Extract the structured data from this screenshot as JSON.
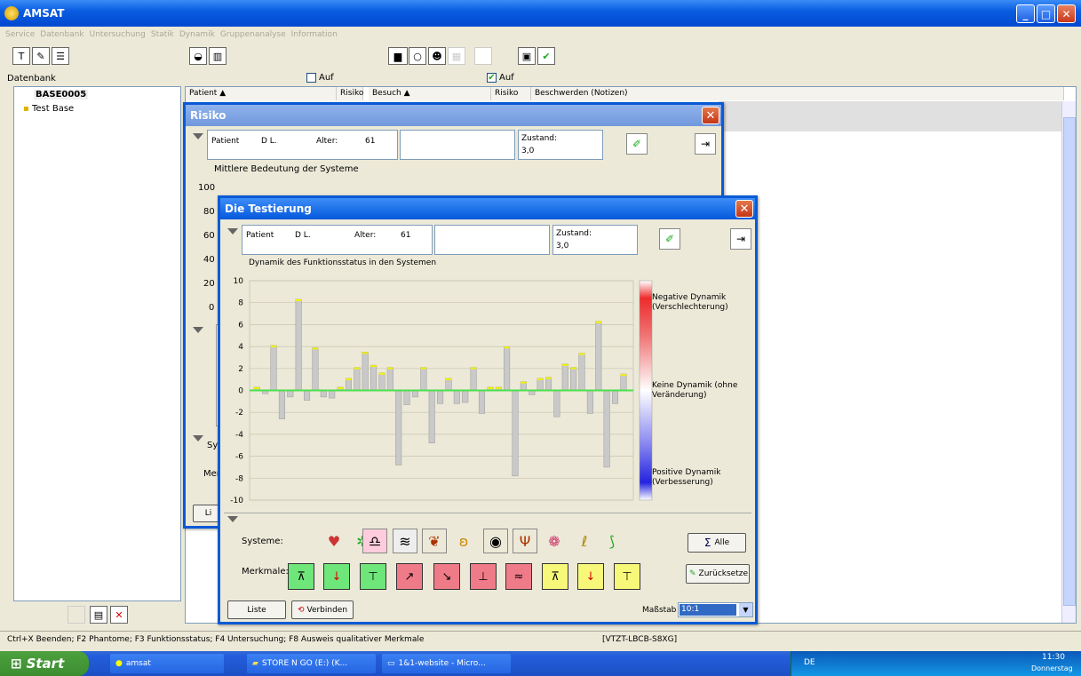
{
  "app": {
    "title": "AMSAT"
  },
  "menu": [
    "Service",
    "Datenbank",
    "Untersuchung",
    "Statik",
    "Dynamik",
    "Gruppenanalyse",
    "Information"
  ],
  "left": {
    "label": "Datenbank",
    "db_name": "BASE0005",
    "item": "Test Base"
  },
  "topchecks": {
    "check1": "Auf",
    "check2": "Auf"
  },
  "table": {
    "col_patient": "Patient",
    "col_risiko": "Risiko",
    "col_besuch": "Besuch",
    "col_risiko2": "Risiko",
    "col_beschwerden": "Beschwerden (Notizen)"
  },
  "risiko": {
    "title": "Risiko",
    "patient_label": "Patient",
    "patient_name": "D L.",
    "alter_label": "Alter:",
    "alter_value": "61",
    "zustand_label": "Zustand:",
    "zustand_value": "3,0",
    "chart_title": "Mittlere Bedeutung der Systeme",
    "ticks": [
      "100",
      "80",
      "60",
      "40",
      "20",
      "0"
    ],
    "sy": "Sy",
    "mer": "Mer",
    "li": "Li"
  },
  "testierung": {
    "title": "Die Testierung",
    "patient_label": "Patient",
    "patient_name": "D L.",
    "alter_label": "Alter:",
    "alter_value": "61",
    "zustand_label": "Zustand:",
    "zustand_value": "3,0",
    "systeme_label": "Systeme:",
    "merkmale_label": "Merkmale:",
    "alle_button": "Alle",
    "zurueck_button": "Zurücksetze",
    "liste_button": "Liste",
    "verbinden_button": "Verbinden",
    "massstab_label": "Maßstab",
    "massstab_value": "10:1"
  },
  "legend": {
    "negative": "Negative Dynamik (Verschlechterung)",
    "neutral": "Keine Dynamik (ohne Veränderung)",
    "positive": "Positive Dynamik (Verbesserung)"
  },
  "status": {
    "hint": "Ctrl+X Beenden; F2 Phantome; F3 Funktionsstatus; F4 Untersuchung; F8 Ausweis qualitativer Merkmale",
    "computer": "[VTZT-LBCB-S8XG]"
  },
  "taskbar": {
    "start": "Start",
    "t1": "amsat",
    "t2": "STORE N GO (E:) (K...",
    "t3": "1&1-website - Micro...",
    "lang": "DE",
    "time": "11:30",
    "day": "Donnerstag"
  },
  "chart_data": {
    "type": "bar",
    "title": "Dynamik des Funktionsstatus in den Systemen",
    "ylim": [
      -10,
      10
    ],
    "yticks": [
      "10",
      "8",
      "6",
      "4",
      "2",
      "0",
      "-2",
      "-4",
      "-6",
      "-8",
      "-10"
    ],
    "values": [
      0.3,
      -0.3,
      4.1,
      -2.6,
      -0.6,
      8.3,
      -0.9,
      3.9,
      -0.6,
      -0.7,
      0.3,
      1.1,
      2.1,
      3.5,
      2.3,
      1.6,
      2.1,
      -6.8,
      -1.3,
      -0.6,
      2.1,
      -4.8,
      -1.2,
      1.1,
      -1.2,
      -1.1,
      2.1,
      -2.1,
      0.3,
      0.3,
      4.0,
      -7.8,
      0.8,
      -0.4,
      1.1,
      1.2,
      -2.4,
      2.4,
      2.1,
      3.4,
      -2.1,
      6.3,
      -7.0,
      -1.2,
      1.5
    ]
  }
}
